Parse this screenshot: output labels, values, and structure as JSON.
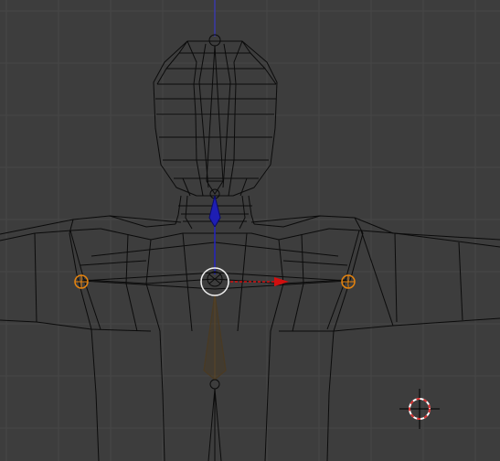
{
  "viewport": {
    "name": "3d-viewport",
    "background": "#3d3d3d",
    "grid_color": "#474747",
    "wire_color": "#0b0b0b",
    "z_axis_color": "#3a3aa8"
  },
  "armature": {
    "selected_bone_color": "#1e1eb4",
    "inactive_bone_color": "#4a3a22",
    "joint_color": "#e6840f"
  },
  "gizmo": {
    "x_axis_color": "#d10f0f",
    "pivot_ring_color": "#f2f2f2"
  },
  "cursor_3d": {
    "ring_color_a": "#d83030",
    "ring_color_b": "#ffffff",
    "crosshair_color": "#000000"
  }
}
